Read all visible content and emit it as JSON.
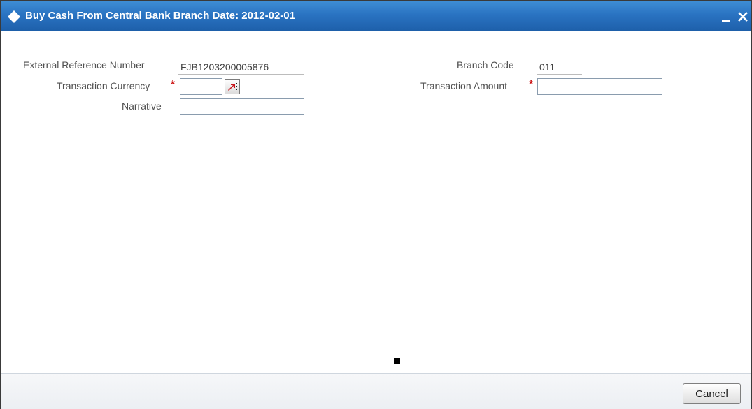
{
  "window": {
    "title": "Buy Cash From Central Bank  Branch Date: 2012-02-01",
    "minimize_icon": "minimize-icon",
    "close_icon": "close-icon",
    "title_icon": "diamond-icon"
  },
  "form": {
    "external_reference": {
      "label": "External Reference Number",
      "value": "FJB1203200005876"
    },
    "branch_code": {
      "label": "Branch Code",
      "value": "011"
    },
    "transaction_currency": {
      "label": "Transaction Currency",
      "required_mark": "*",
      "value": "",
      "lov_icon": "lov-search-icon"
    },
    "transaction_amount": {
      "label": "Transaction Amount",
      "required_mark": "*",
      "value": ""
    },
    "narrative": {
      "label": "Narrative",
      "value": ""
    }
  },
  "footer": {
    "cancel_label": "Cancel"
  },
  "colors": {
    "titlebar": "#2a73c2",
    "required": "#cc1111",
    "label": "#505050"
  }
}
